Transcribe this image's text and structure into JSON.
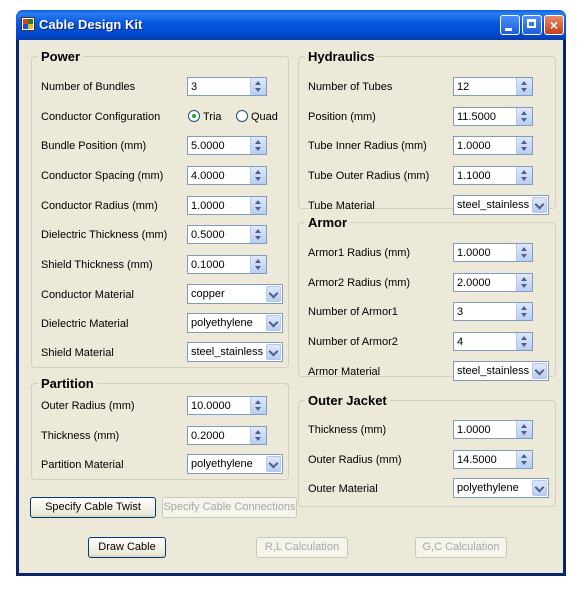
{
  "window": {
    "title": "Cable Design Kit",
    "close_glyph": "×"
  },
  "power": {
    "label": "Power",
    "number_of_bundles": {
      "label": "Number of Bundles",
      "value": "3"
    },
    "conductor_configuration": {
      "label": "Conductor Configuration",
      "options": [
        "Tria",
        "Quad"
      ],
      "selected": "Tria"
    },
    "bundle_position": {
      "label": "Bundle Position (mm)",
      "value": "5.0000"
    },
    "conductor_spacing": {
      "label": "Conductor Spacing (mm)",
      "value": "4.0000"
    },
    "conductor_radius": {
      "label": "Conductor Radius (mm)",
      "value": "1.0000"
    },
    "dielectric_thickness": {
      "label": "Dielectric Thickness (mm)",
      "value": "0.5000"
    },
    "shield_thickness": {
      "label": "Shield Thickness (mm)",
      "value": "0.1000"
    },
    "conductor_material": {
      "label": "Conductor Material",
      "value": "copper"
    },
    "dielectric_material": {
      "label": "Dielectric Material",
      "value": "polyethylene"
    },
    "shield_material": {
      "label": "Shield Material",
      "value": "steel_stainless"
    }
  },
  "partition": {
    "label": "Partition",
    "outer_radius": {
      "label": "Outer Radius (mm)",
      "value": "10.0000"
    },
    "thickness": {
      "label": "Thickness (mm)",
      "value": "0.2000"
    },
    "material": {
      "label": "Partition Material",
      "value": "polyethylene"
    }
  },
  "hydraulics": {
    "label": "Hydraulics",
    "number_of_tubes": {
      "label": "Number of Tubes",
      "value": "12"
    },
    "position": {
      "label": "Position (mm)",
      "value": "11.5000"
    },
    "tube_inner_radius": {
      "label": "Tube Inner Radius (mm)",
      "value": "1.0000"
    },
    "tube_outer_radius": {
      "label": "Tube Outer Radius (mm)",
      "value": "1.1000"
    },
    "tube_material": {
      "label": "Tube Material",
      "value": "steel_stainless"
    }
  },
  "armor": {
    "label": "Armor",
    "armor1_radius": {
      "label": "Armor1 Radius (mm)",
      "value": "1.0000"
    },
    "armor2_radius": {
      "label": "Armor2 Radius (mm)",
      "value": "2.0000"
    },
    "number_of_armor1": {
      "label": "Number of Armor1",
      "value": "3"
    },
    "number_of_armor2": {
      "label": "Number of Armor2",
      "value": "4"
    },
    "material": {
      "label": "Armor Material",
      "value": "steel_stainless"
    }
  },
  "outer_jacket": {
    "label": "Outer Jacket",
    "thickness": {
      "label": "Thickness (mm)",
      "value": "1.0000"
    },
    "outer_radius": {
      "label": "Outer Radius (mm)",
      "value": "14.5000"
    },
    "material": {
      "label": "Outer Material",
      "value": "polyethylene"
    }
  },
  "buttons": {
    "specify_twist": "Specify Cable Twist",
    "specify_connections": "Specify Cable Connections",
    "draw_cable": "Draw Cable",
    "rl_calculation": "R,L Calculation",
    "gc_calculation": "G,C Calculation"
  }
}
